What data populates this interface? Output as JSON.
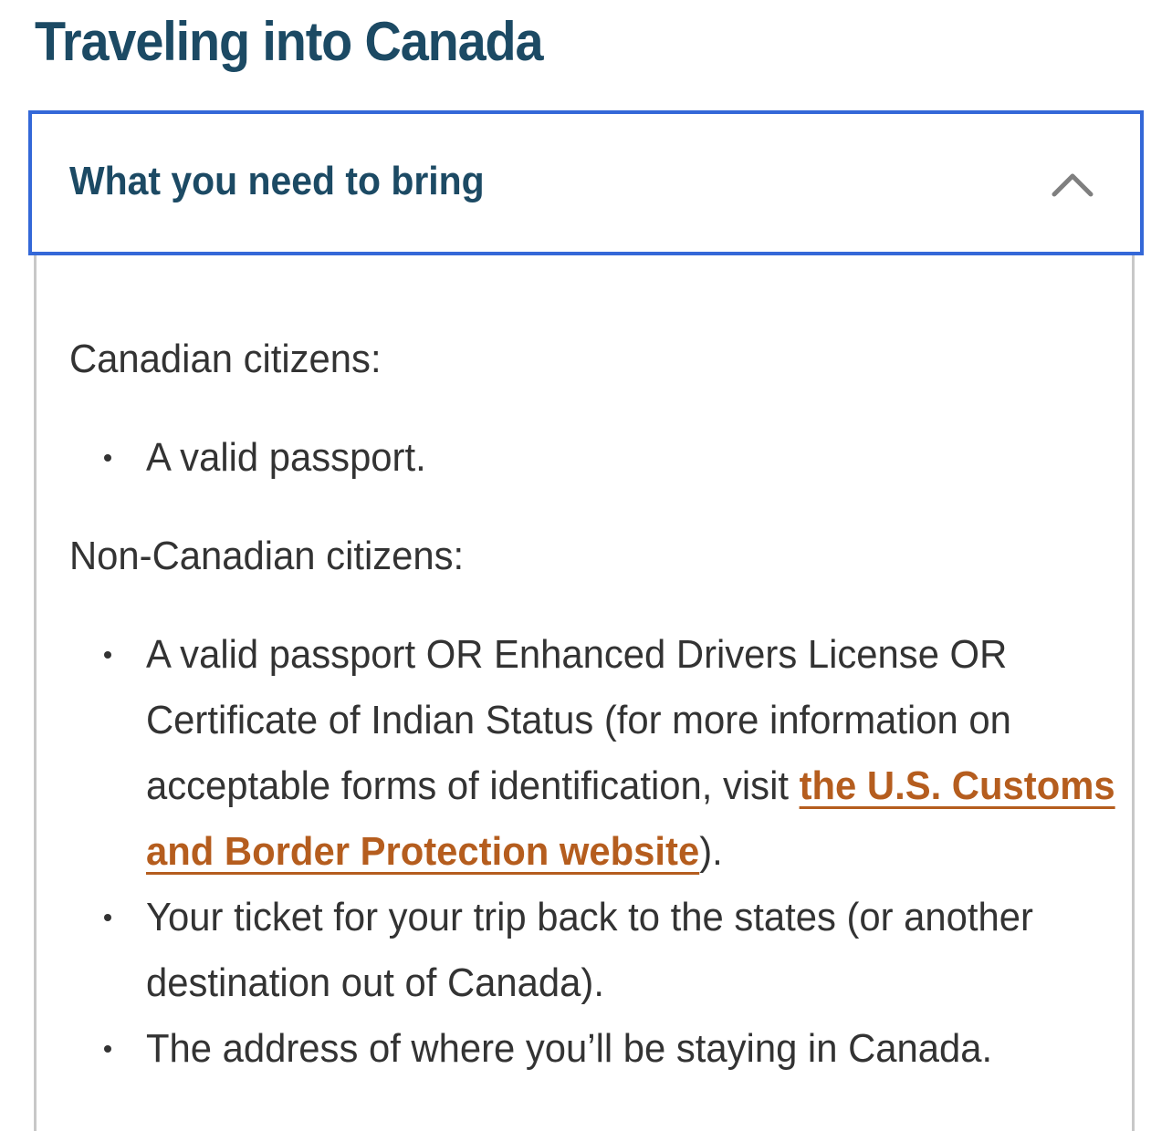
{
  "page": {
    "title": "Traveling into Canada"
  },
  "accordion": {
    "title": "What you need to bring",
    "expanded": true,
    "toggle_icon": "chevron-up-icon",
    "colors": {
      "focus_border": "#3468d8",
      "heading": "#1c4a64",
      "link": "#b55d1e",
      "text": "#333333"
    },
    "sections": [
      {
        "heading": "Canadian citizens:",
        "items": [
          {
            "text": "A valid passport."
          }
        ]
      },
      {
        "heading": "Non-Canadian citizens:",
        "items": [
          {
            "text_before": "A valid passport OR Enhanced Drivers License OR Certificate of Indian Status (for more information on acceptable forms of identification, visit ",
            "link_text": "the U.S. Customs and Border Protection website",
            "text_after": ")."
          },
          {
            "text": "Your ticket for your trip back to the states (or another destination out of Canada)."
          },
          {
            "text": "The address of where you’ll be staying in Canada."
          }
        ]
      }
    ]
  }
}
